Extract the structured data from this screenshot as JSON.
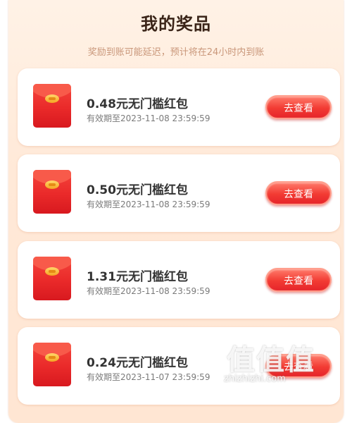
{
  "header": {
    "title": "我的奖品",
    "subtitle": "奖励到账可能延迟，预计将在24小时内到账"
  },
  "prizes": [
    {
      "name": "0.48元无门槛红包",
      "expiry": "有效期至2023-11-08 23:59:59",
      "button": "去查看"
    },
    {
      "name": "0.50元无门槛红包",
      "expiry": "有效期至2023-11-08 23:59:59",
      "button": "去查看"
    },
    {
      "name": "1.31元无门槛红包",
      "expiry": "有效期至2023-11-08 23:59:59",
      "button": "去查看"
    },
    {
      "name": "0.24元无门槛红包",
      "expiry": "有效期至2023-11-07 23:59:59",
      "button": "去查看"
    }
  ],
  "icons": {
    "prize": "red-envelope-icon"
  },
  "colors": {
    "button": "#f23b33",
    "envelope": "#ea2a2a",
    "subtitle": "#c9977a"
  },
  "watermark": {
    "logo": "值值值",
    "url": "zhizhizhi.com"
  }
}
